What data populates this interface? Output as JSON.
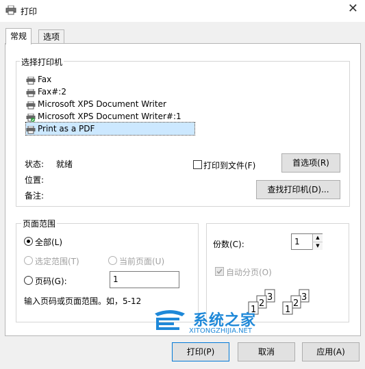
{
  "window": {
    "title": "打印",
    "close_glyph": "✕"
  },
  "tabs": [
    {
      "label": "常规",
      "active": true
    },
    {
      "label": "选项",
      "active": false
    }
  ],
  "printer_group": {
    "label": "选择打印机",
    "printers": [
      {
        "name": "Fax"
      },
      {
        "name": "Fax#:2"
      },
      {
        "name": "Microsoft XPS Document Writer"
      },
      {
        "name": "Microsoft XPS Document Writer#:1"
      },
      {
        "name": "Print as a PDF"
      }
    ],
    "status_label": "状态:",
    "status_value": "就绪",
    "location_label": "位置:",
    "comment_label": "备注:",
    "print_to_file_label": "打印到文件(F)",
    "preferences_label": "首选项(R)",
    "find_printer_label": "查找打印机(D)..."
  },
  "page_range": {
    "label": "页面范围",
    "all_label": "全部(L)",
    "selection_label": "选定范围(T)",
    "current_page_label": "当前页面(U)",
    "pages_label": "页码(G):",
    "pages_value": "1",
    "hint": "输入页码或页面范围。如，5-12"
  },
  "copies": {
    "label": "份数(C):",
    "value": "1",
    "collate_label": "自动分页(O)"
  },
  "collate_pages": [
    "1",
    "2",
    "3"
  ],
  "buttons": {
    "print": "打印(P)",
    "cancel": "取消",
    "apply": "应用(A)"
  },
  "watermark": {
    "brand": "系统之家",
    "url": "XITONGZHIJIA.NET"
  },
  "colors": {
    "selection": "#cce8ff",
    "accent": "#0078d7",
    "watermark_blue": "#1e88d8"
  }
}
